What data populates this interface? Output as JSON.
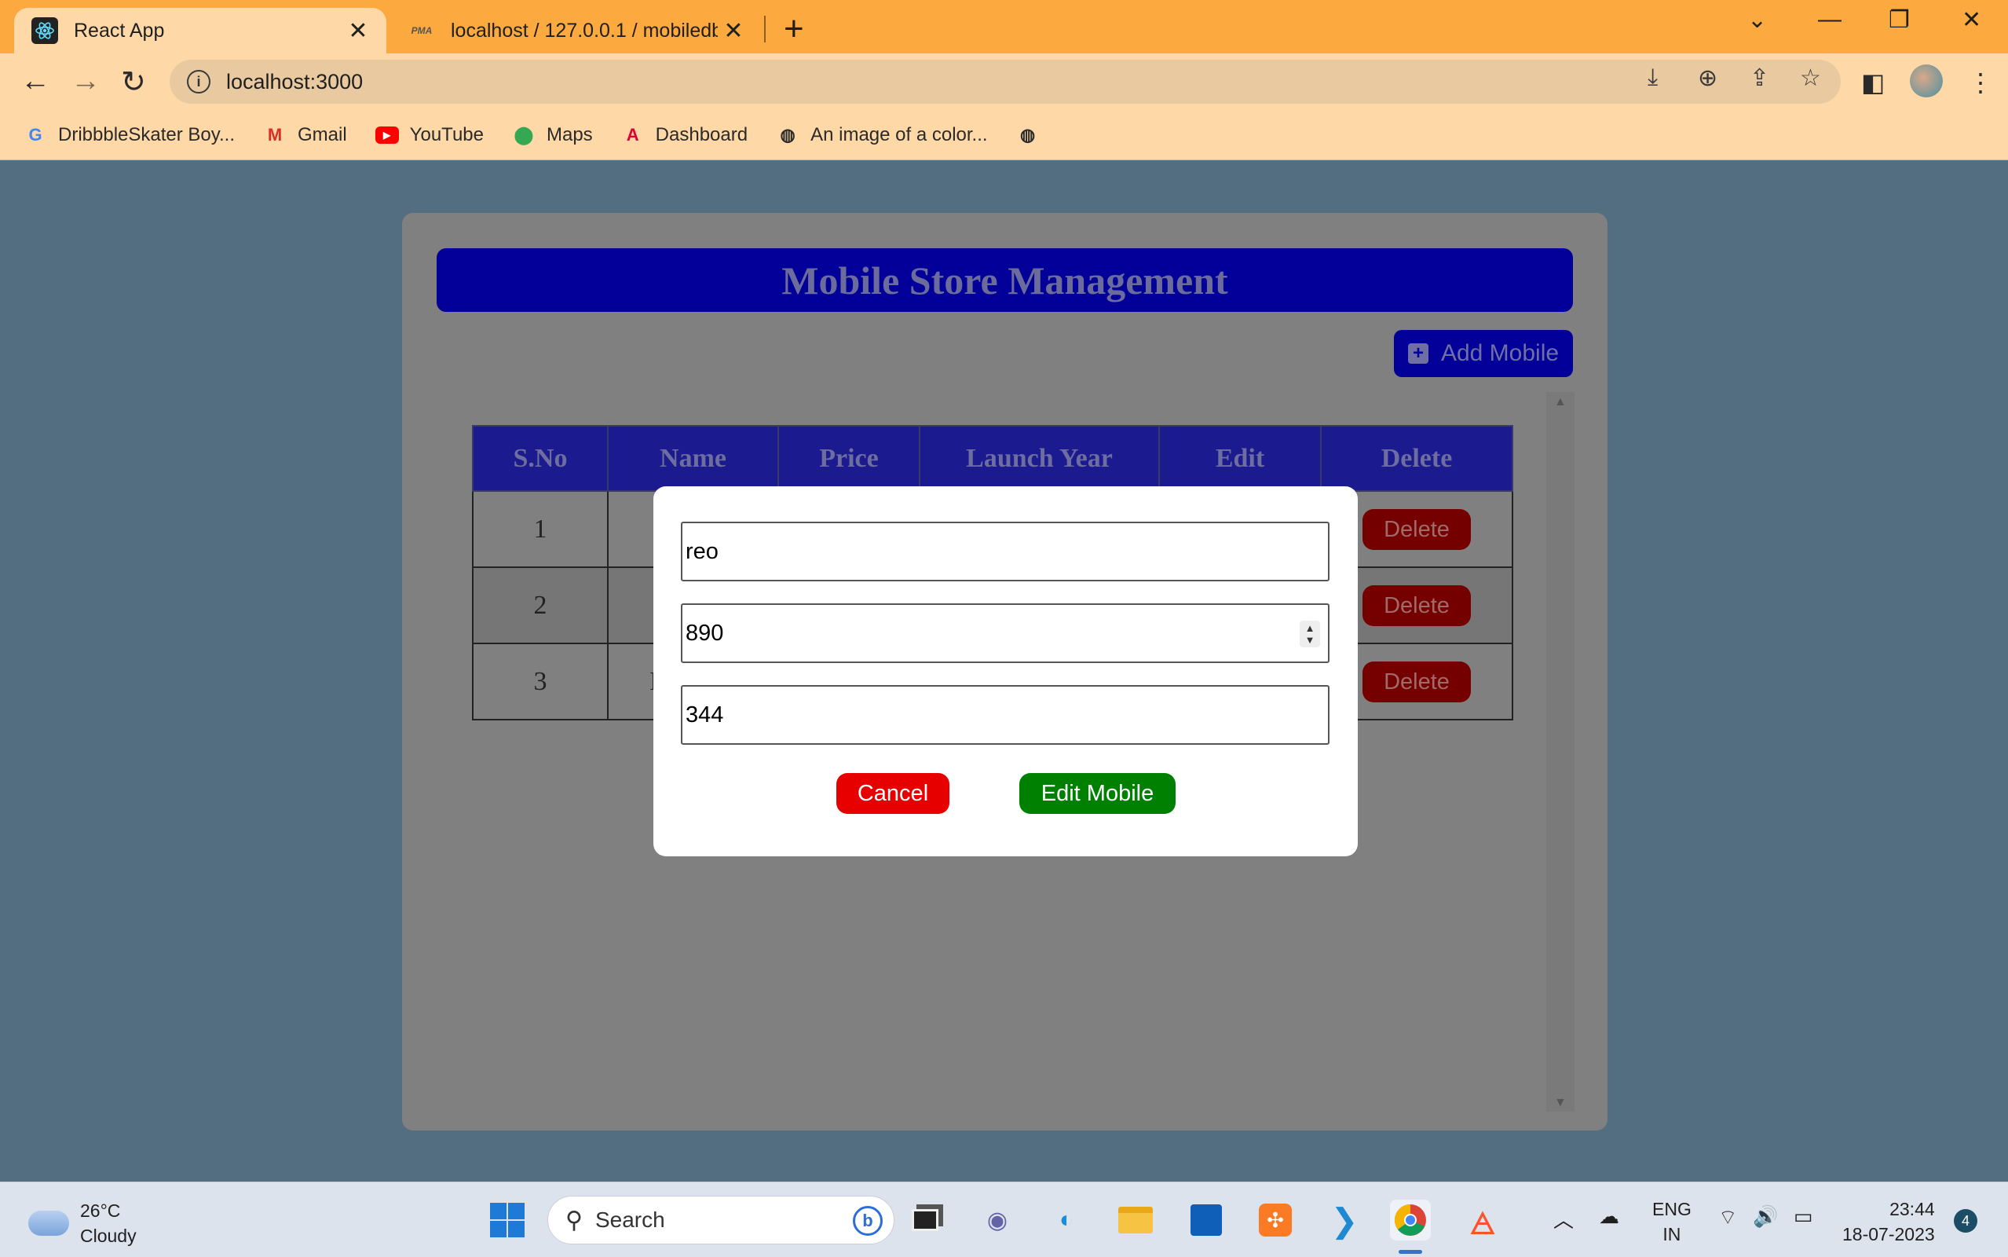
{
  "browser": {
    "tabs": [
      {
        "title": "React App",
        "active": true,
        "icon": "react-logo-icon"
      },
      {
        "title": "localhost / 127.0.0.1 / mobiledb |",
        "active": false,
        "icon": "phpmyadmin-icon",
        "icon_text": "PMA"
      }
    ],
    "new_tab": "+",
    "url": "localhost:3000",
    "bookmarks": [
      {
        "label": "DribbbleSkater Boy...",
        "icon": "google-icon"
      },
      {
        "label": "Gmail",
        "icon": "gmail-icon"
      },
      {
        "label": "YouTube",
        "icon": "youtube-icon"
      },
      {
        "label": "Maps",
        "icon": "maps-icon"
      },
      {
        "label": "Dashboard",
        "icon": "angular-icon"
      },
      {
        "label": "An image of a color...",
        "icon": "globe-icon"
      }
    ]
  },
  "app": {
    "title": "Mobile Store Management",
    "add_button": "Add Mobile",
    "table": {
      "headers": [
        "S.No",
        "Name",
        "Price",
        "Launch Year",
        "Edit",
        "Delete"
      ],
      "rows": [
        {
          "sno": "1",
          "name_partial": "",
          "delete": "Delete"
        },
        {
          "sno": "2",
          "name_partial": "",
          "delete": "Delete"
        },
        {
          "sno": "3",
          "name_partial": "I",
          "delete": "Delete"
        }
      ]
    },
    "modal": {
      "name_value": "reo",
      "price_value": "890",
      "year_value": "344",
      "cancel_label": "Cancel",
      "submit_label": "Edit Mobile"
    }
  },
  "taskbar": {
    "weather_temp": "26°C",
    "weather_desc": "Cloudy",
    "search_placeholder": "Search",
    "lang_line1": "ENG",
    "lang_line2": "IN",
    "time": "23:44",
    "date": "18-07-2023",
    "notification_count": "4"
  },
  "colors": {
    "tab_bar": "#fca93f",
    "toolbar": "#fed8a6",
    "page_bg": "#526e80",
    "header_bg": "#020099",
    "delete_btn": "#750000",
    "cancel_btn": "#e60000",
    "edit_btn": "#008000"
  }
}
